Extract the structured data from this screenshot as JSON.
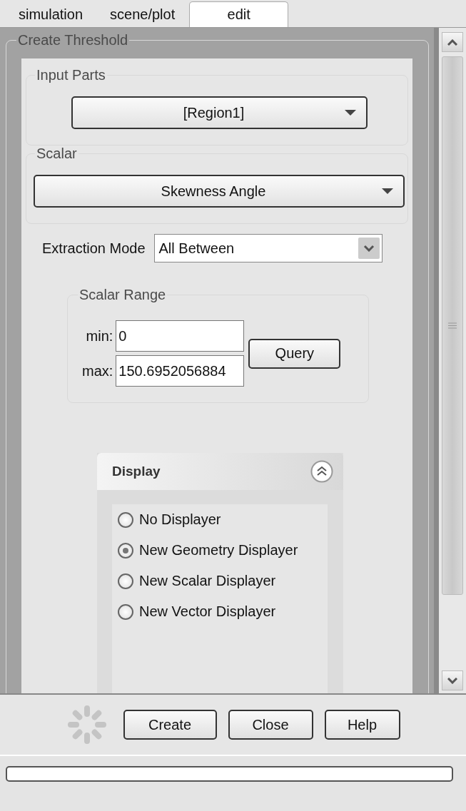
{
  "tabs": [
    {
      "label": "simulation",
      "selected": false
    },
    {
      "label": "scene/plot",
      "selected": false
    },
    {
      "label": "edit",
      "selected": true
    }
  ],
  "panel": {
    "title": "Create Threshold"
  },
  "input_parts": {
    "title": "Input Parts",
    "value": "[Region1]"
  },
  "scalar": {
    "title": "Scalar",
    "value": "Skewness Angle"
  },
  "extraction_mode": {
    "label": "Extraction Mode",
    "value": "All Between"
  },
  "scalar_range": {
    "title": "Scalar Range",
    "min_label": "min:",
    "min": "0",
    "max_label": "max:",
    "max": "150.6952056884",
    "button": "Query"
  },
  "display": {
    "title": "Display",
    "expanded": true,
    "options": [
      {
        "label": "No Displayer",
        "selected": false
      },
      {
        "label": "New Geometry Displayer",
        "selected": true
      },
      {
        "label": "New Scalar Displayer",
        "selected": false
      },
      {
        "label": "New Vector Displayer",
        "selected": false
      }
    ]
  },
  "buttons": [
    "Create",
    "Close",
    "Help"
  ],
  "progress": {
    "level": 0
  }
}
